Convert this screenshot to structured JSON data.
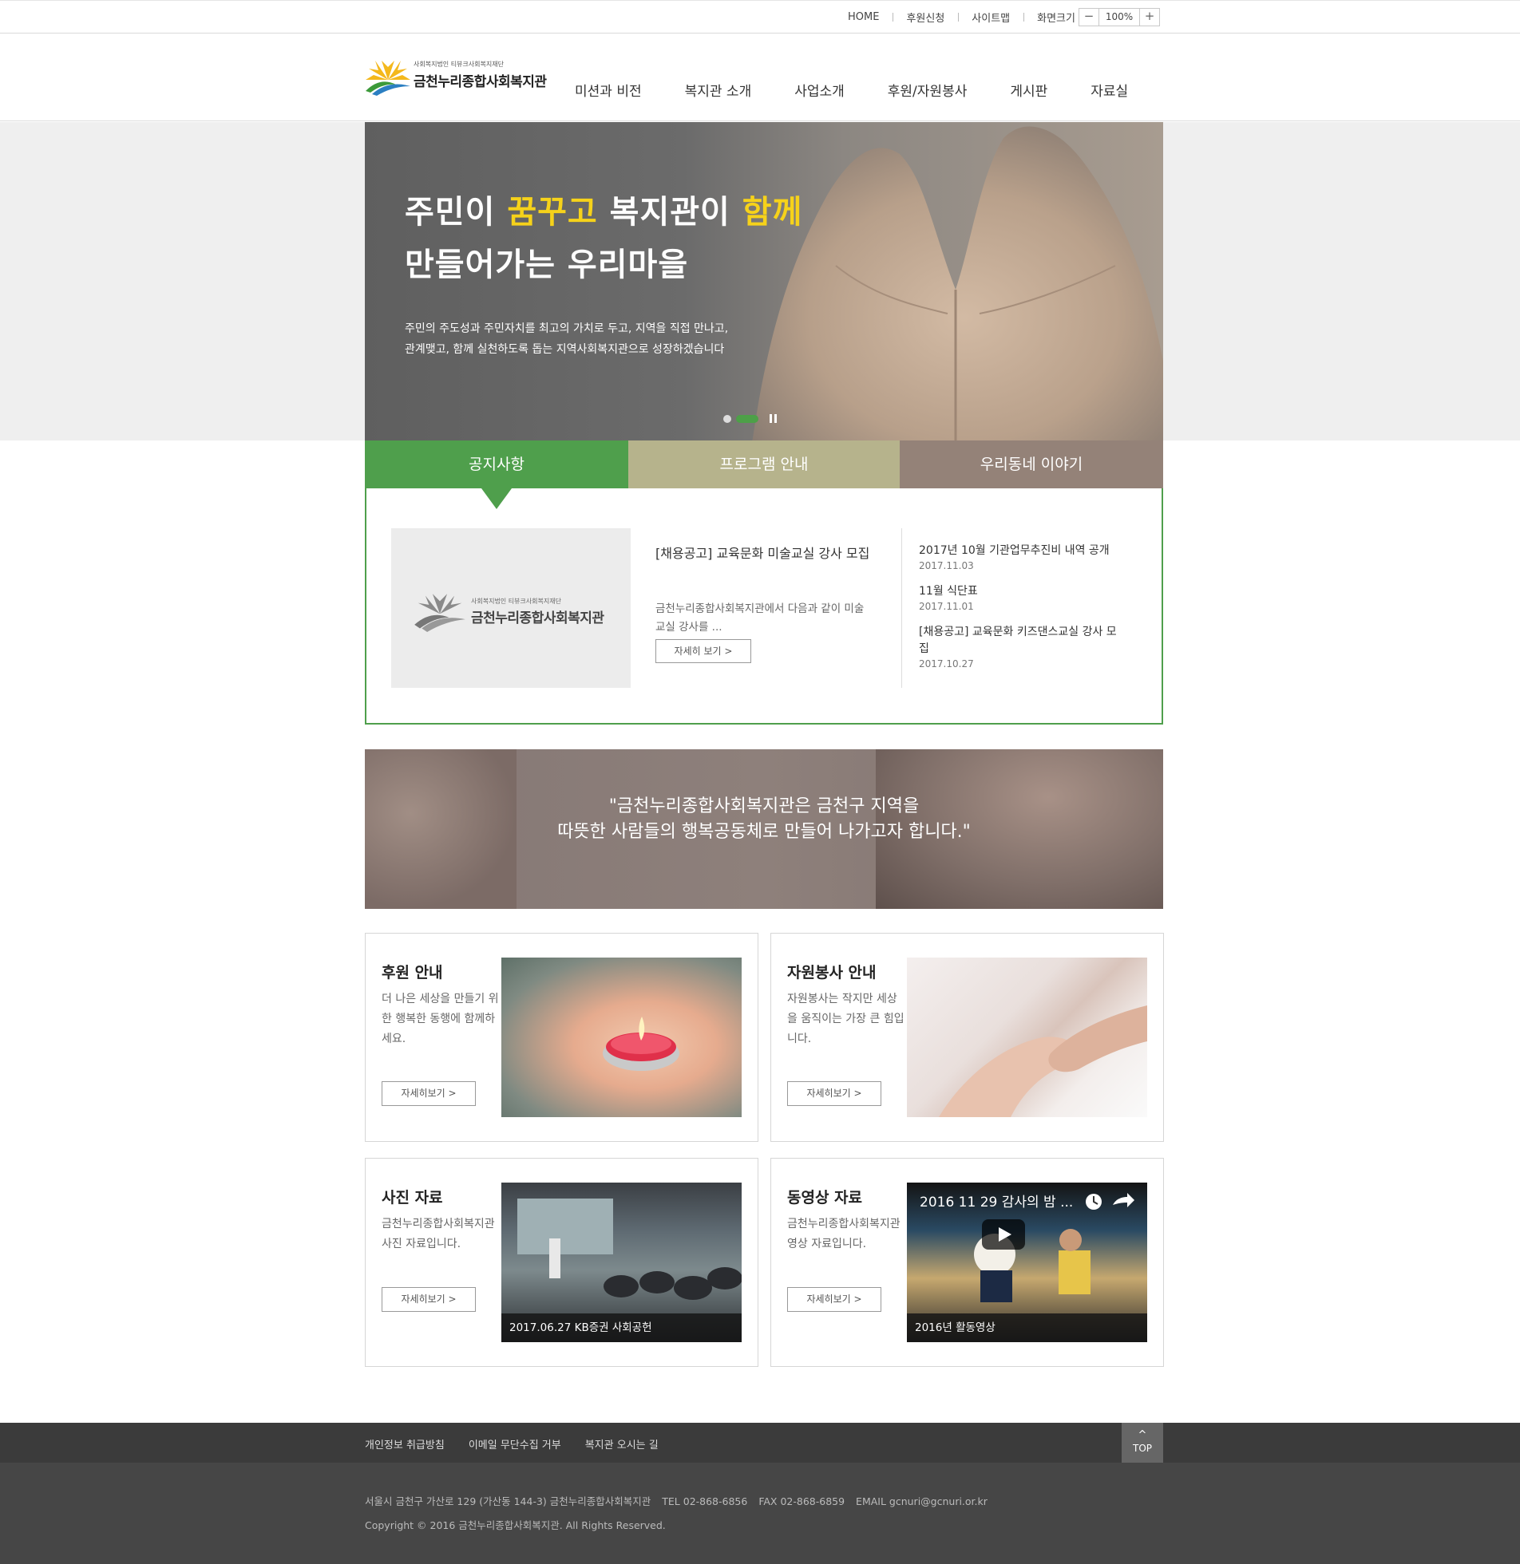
{
  "util": {
    "links": [
      "HOME",
      "후원신청",
      "사이트맵",
      "화면크기"
    ],
    "zoom_minus": "−",
    "zoom_value": "100%",
    "zoom_plus": "+"
  },
  "header": {
    "logo_sub": "사회복지법인 티뷰크사회복지재단",
    "logo_main": "금천누리종합사회복지관",
    "nav": [
      "미션과 비전",
      "복지관 소개",
      "사업소개",
      "후원/자원봉사",
      "게시판",
      "자료실"
    ]
  },
  "hero": {
    "title_line1_a": "주민이 ",
    "title_line1_hl1": "꿈꾸고",
    "title_line1_b": " 복지관이 ",
    "title_line1_hl2": "함께",
    "title_line2": "만들어가는 우리마을",
    "desc_line1": "주민의 주도성과 주민자치를 최고의 가치로 두고, 지역을 직접 만나고,",
    "desc_line2": "관계맺고, 함께 실천하도록 돕는 지역사회복지관으로 성장하겠습니다"
  },
  "tabs": [
    "공지사항",
    "프로그램 안내",
    "우리동네 이야기"
  ],
  "notice": {
    "thumb_sub": "사회복지법인 티뷰크사회복지재단",
    "thumb_main": "금천누리종합사회복지관",
    "featured_title": "[채용공고] 교육문화 미술교실 강사 모집",
    "featured_desc": "금천누리종합사회복지관에서 다음과 같이 미술교실 강사를 ...",
    "featured_btn": "자세히 보기  >",
    "items": [
      {
        "title": "2017년 10월 기관업무추진비 내역 공개",
        "date": "2017.11.03"
      },
      {
        "title": "11월 식단표",
        "date": "2017.11.01"
      },
      {
        "title": "[채용공고] 교육문화 키즈댄스교실 강사 모집",
        "date": "2017.10.27"
      }
    ]
  },
  "quote": {
    "line1": "\"금천누리종합사회복지관은 금천구 지역을",
    "line2": "따뜻한 사람들의 행복공동체로 만들어 나가고자 합니다.\""
  },
  "cards": [
    {
      "title": "후원 안내",
      "desc": "더 나은 세상을 만들기 위한 행복한 동행에 함께하세요.",
      "btn": "자세히보기  >",
      "caption": ""
    },
    {
      "title": "자원봉사 안내",
      "desc": "자원봉사는 작지만 세상을 움직이는 가장 큰 힘입니다.",
      "btn": "자세히보기  >",
      "caption": ""
    },
    {
      "title": "사진 자료",
      "desc": "금천누리종합사회복지관 사진 자료입니다.",
      "btn": "자세히보기  >",
      "caption": "2017.06.27 KB증권 사회공헌"
    },
    {
      "title": "동영상 자료",
      "desc": "금천누리종합사회복지관 영상 자료입니다.",
      "btn": "자세히보기  >",
      "caption": "2016년 활동영상",
      "video_title": "2016 11 29 감사의 밤 ..."
    }
  ],
  "footer": {
    "links": [
      "개인정보 취급방침",
      "이메일 무단수집 거부",
      "복지관 오시는 길"
    ],
    "top_label": "TOP",
    "address": "서울시 금천구 가산로 129 (가산동 144-3) 금천누리종합사회복지관",
    "tel": "TEL 02-868-6856",
    "fax": "FAX 02-868-6859",
    "email": "EMAIL gcnuri@gcnuri.or.kr",
    "copyright": "Copyright © 2016 금천누리종합사회복지관. All Rights Reserved."
  },
  "colors": {
    "green": "#4f9f4c",
    "khaki": "#b6b38c",
    "taupe": "#948278",
    "highlight": "#f6d21a",
    "footer_dark": "#3b3b3b"
  }
}
